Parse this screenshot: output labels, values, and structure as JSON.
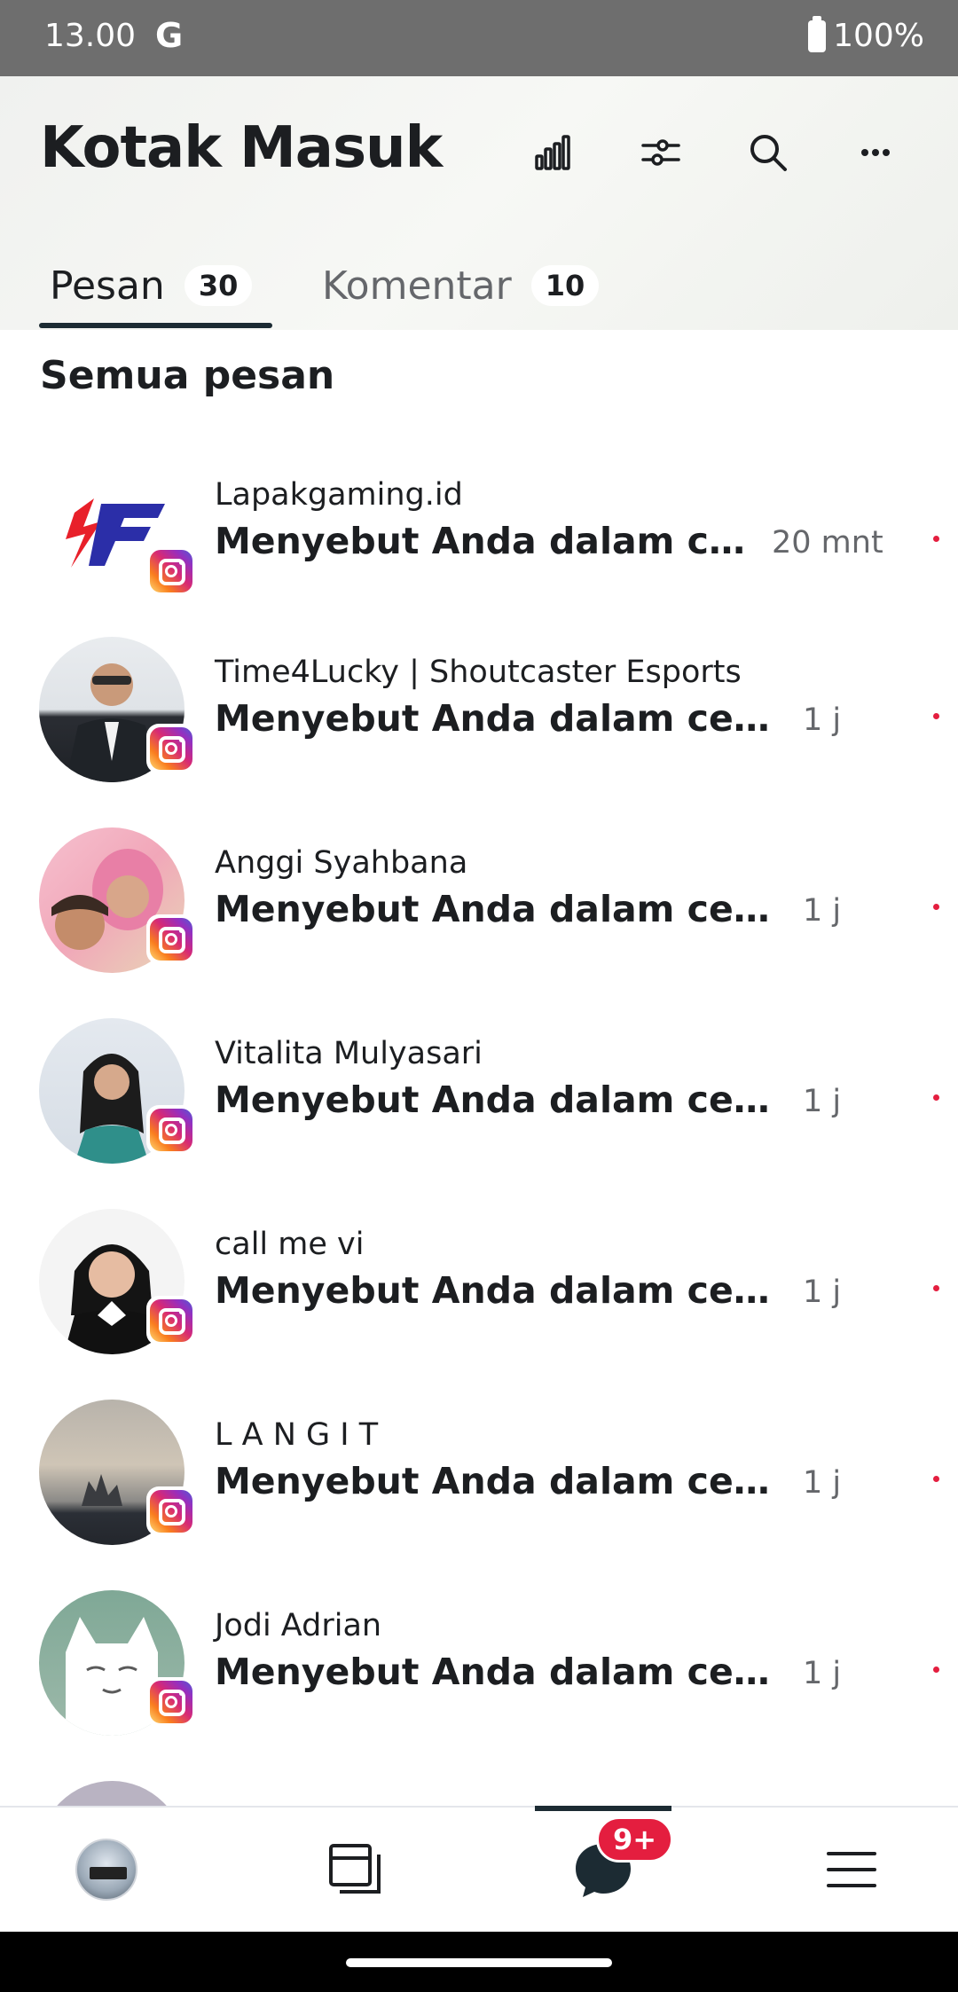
{
  "status_bar": {
    "time": "13.00",
    "network": "G",
    "battery": "100%"
  },
  "header": {
    "title": "Kotak Masuk",
    "icons": [
      "insights-icon",
      "filter-icon",
      "search-icon",
      "more-icon"
    ]
  },
  "tabs": [
    {
      "label": "Pesan",
      "count": "30",
      "active": true
    },
    {
      "label": "Komentar",
      "count": "10",
      "active": false
    }
  ],
  "section_title": "Semua pesan",
  "messages": [
    {
      "name": "Lapakgaming.id",
      "text": "Menyebut Anda dalam cerit...",
      "time": "20 mnt",
      "platform": "instagram",
      "unread": true
    },
    {
      "name": "Time4Lucky | Shoutcaster Esports",
      "text": "Menyebut Anda dalam ceritanya",
      "time": "1 j",
      "platform": "instagram",
      "unread": true
    },
    {
      "name": "Anggi Syahbana",
      "text": "Menyebut Anda dalam ceritanya",
      "time": "1 j",
      "platform": "instagram",
      "unread": true
    },
    {
      "name": "Vitalita Mulyasari",
      "text": "Menyebut Anda dalam ceritanya",
      "time": "1 j",
      "platform": "instagram",
      "unread": true
    },
    {
      "name": "call me vi",
      "text": "Menyebut Anda dalam ceritanya",
      "time": "1 j",
      "platform": "instagram",
      "unread": true
    },
    {
      "name": "L A N G I T",
      "text": "Menyebut Anda dalam ceritanya",
      "time": "1 j",
      "platform": "instagram",
      "unread": true
    },
    {
      "name": "Jodi Adrian",
      "text": "Menyebut Anda dalam ceritanya",
      "time": "1 j",
      "platform": "instagram",
      "unread": true
    }
  ],
  "bottom_nav": {
    "items": [
      "profile-avatar",
      "pages-icon",
      "inbox-icon",
      "menu-icon"
    ],
    "active": "inbox-icon",
    "inbox_badge": "9+"
  },
  "colors": {
    "accent_dark": "#1c2b33",
    "badge_red": "#e41e3f",
    "secondary_text": "#65676b"
  }
}
